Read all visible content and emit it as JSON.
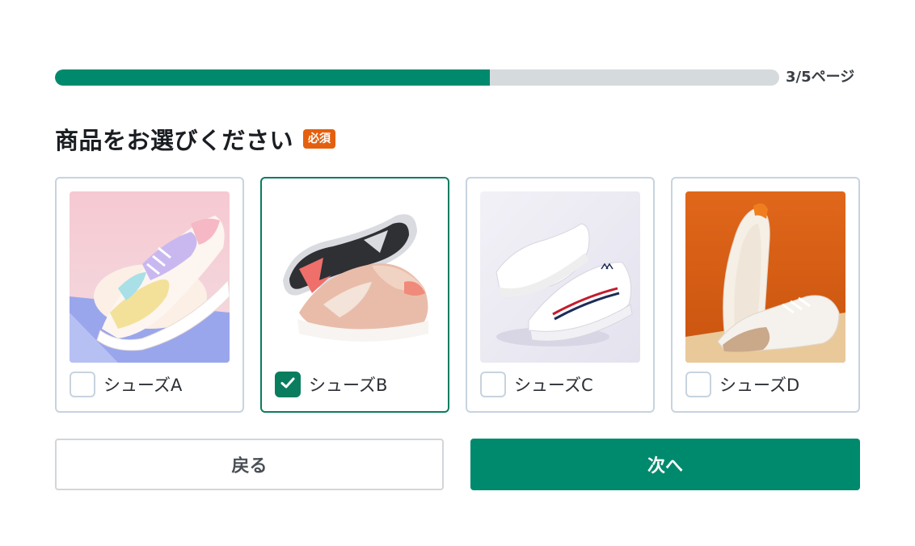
{
  "progress": {
    "current": 3,
    "total": 5,
    "fraction": 0.6,
    "label": "3/5ページ"
  },
  "question": {
    "title": "商品をお選びください",
    "required_badge": "必須"
  },
  "options": [
    {
      "label": "シューズA",
      "checked": false,
      "image": "pastel-sneaker-photo"
    },
    {
      "label": "シューズB",
      "checked": true,
      "image": "pink-chunky-sneaker-photo"
    },
    {
      "label": "シューズC",
      "checked": false,
      "image": "white-sneakers-photo"
    },
    {
      "label": "シューズD",
      "checked": false,
      "image": "tan-white-sneakers-photo"
    }
  ],
  "buttons": {
    "back_label": "戻る",
    "next_label": "次へ"
  },
  "colors": {
    "accent": "#008a6d",
    "selected_border": "#0a7d5f",
    "required": "#e4600f",
    "track": "#d5dadc"
  },
  "icons": {
    "checkmark": "check-icon"
  }
}
